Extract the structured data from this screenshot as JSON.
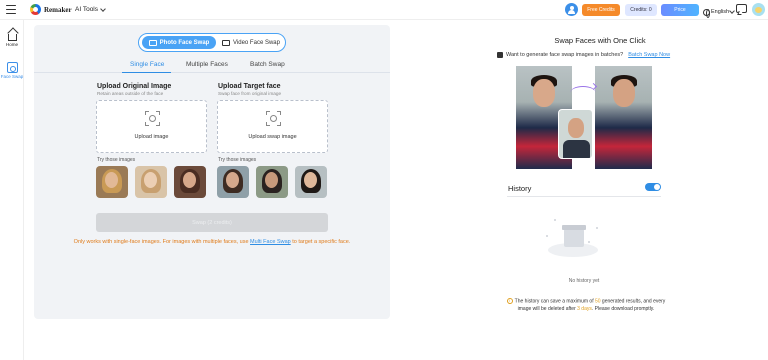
{
  "header": {
    "brand": "Remaker",
    "ai_tools": "AI Tools",
    "free_credits": "Free Credits",
    "credits": "Credits: 0",
    "price": "Price",
    "language": "English"
  },
  "sidebar": {
    "items": [
      {
        "label": "Home"
      },
      {
        "label": "Face Swap"
      }
    ]
  },
  "swap_mode": {
    "photo": "Photo Face Swap",
    "video": "Video Face Swap"
  },
  "tabs": [
    "Single Face",
    "Multiple Faces",
    "Batch Swap"
  ],
  "original": {
    "title": "Upload Original Image",
    "subtitle": "Retain areas outside of the face",
    "button": "Upload image",
    "try_label": "Try those images"
  },
  "target": {
    "title": "Upload Target face",
    "subtitle": "Swap face from original image",
    "button": "Upload swap image",
    "try_label": "Try those images"
  },
  "swap_button": "Swap (2 credits)",
  "notice": {
    "before": "Only works with single-face images. For images with multiple faces, use ",
    "link": "Multi Face Swap",
    "after": " to target a specific face."
  },
  "right": {
    "title": "Swap Faces with One Click",
    "batch_prompt": "Want to generate face swap images in batches?",
    "batch_link": "Batch Swap Now",
    "history_title": "History",
    "no_history": "No history yet",
    "note": {
      "part1": "The history can save a maximum of ",
      "count": "50",
      "part2": " generated results, and every image will be deleted after ",
      "days": "3 days",
      "part3": ". Please download promptly."
    }
  },
  "colors": {
    "accent": "#2f8de4",
    "orange": "#f58a2a",
    "notice": "#e07b1a"
  }
}
